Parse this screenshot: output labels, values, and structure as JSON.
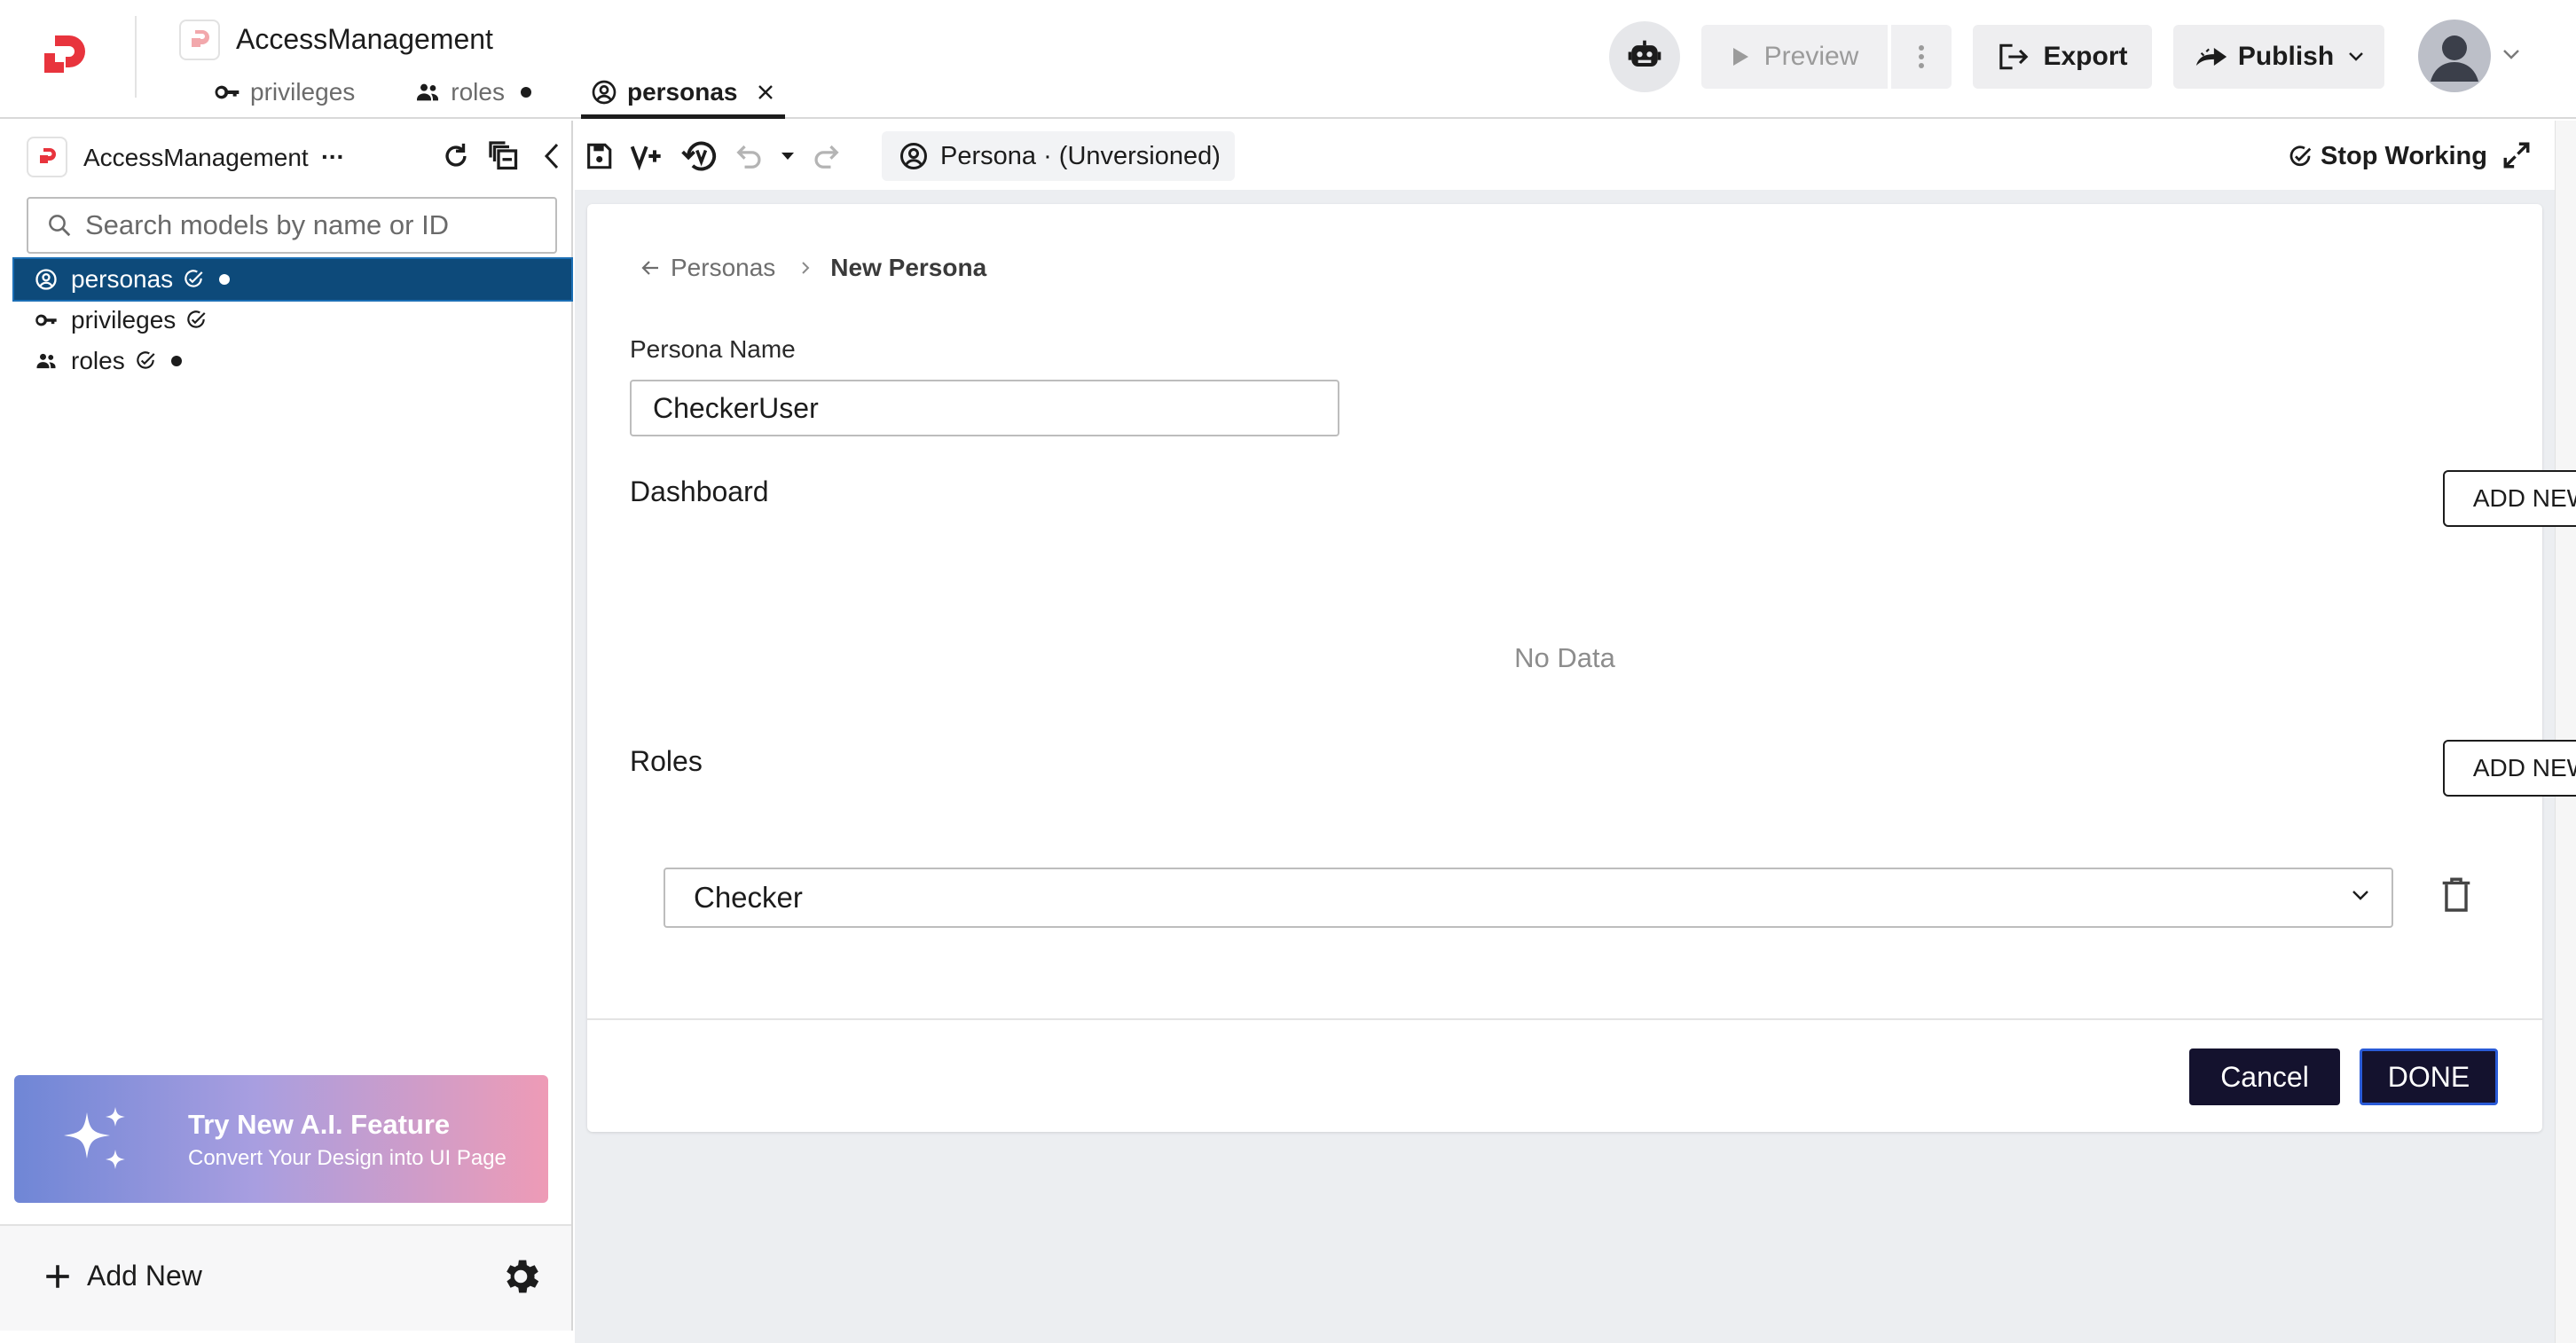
{
  "app": {
    "title": "AccessManagement",
    "icons": {
      "logo": "brand-logo-icon",
      "app": "app-model-icon"
    }
  },
  "file_tabs": [
    {
      "label": "privileges",
      "icon": "key-icon",
      "modified": false,
      "active": false
    },
    {
      "label": "roles",
      "icon": "group-icon",
      "modified": true,
      "active": false
    },
    {
      "label": "personas",
      "icon": "account-circle-icon",
      "modified": false,
      "active": true
    }
  ],
  "header_actions": {
    "assistant_icon": "robot-icon",
    "preview_label": "Preview",
    "export_label": "Export",
    "publish_label": "Publish"
  },
  "sidebar": {
    "project_title": "AccessManagement",
    "more_label": "...",
    "search_placeholder": "Search models by name or ID",
    "items": [
      {
        "label": "personas",
        "icon": "account-circle-icon",
        "checked": true,
        "modified": true,
        "selected": true
      },
      {
        "label": "privileges",
        "icon": "key-icon",
        "checked": true,
        "modified": false,
        "selected": false
      },
      {
        "label": "roles",
        "icon": "group-icon",
        "checked": true,
        "modified": true,
        "selected": false
      }
    ],
    "ai_banner": {
      "title": "Try New A.I. Feature",
      "subtitle": "Convert Your Design into UI Page",
      "icon": "sparkles-icon"
    },
    "footer": {
      "add_new_label": "Add New",
      "settings_icon": "gear-icon"
    }
  },
  "editor_toolbar": {
    "persona_chip": "Persona · (Unversioned)",
    "stop_working_label": "Stop Working"
  },
  "form": {
    "breadcrumb": {
      "parent": "Personas",
      "current": "New Persona"
    },
    "persona_name_label": "Persona Name",
    "persona_name_value": "CheckerUser",
    "dashboard": {
      "title": "Dashboard",
      "add_label": "ADD NEW",
      "empty_text": "No Data"
    },
    "roles": {
      "title": "Roles",
      "add_label": "ADD NEW",
      "selected_role": "Checker"
    },
    "cancel_label": "Cancel",
    "done_label": "DONE"
  },
  "colors": {
    "brand": "#e8343d",
    "selected_row": "#0d4a7a",
    "primary_button": "#14122e",
    "focus_border": "#2a5bd7"
  }
}
